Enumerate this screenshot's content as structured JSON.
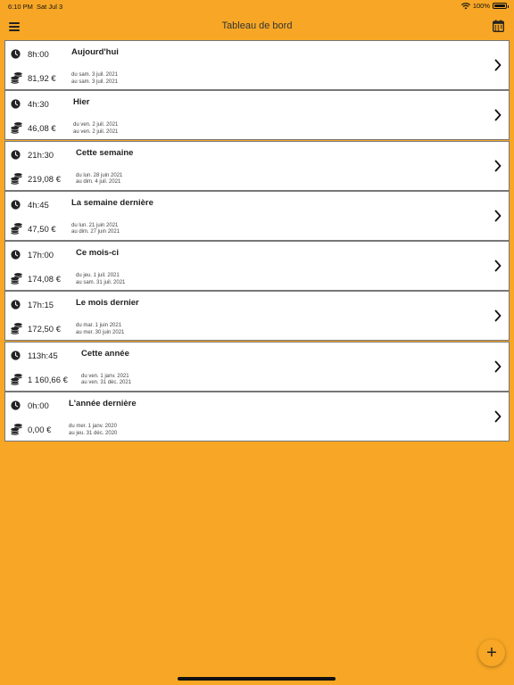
{
  "status_bar": {
    "time": "6:10 PM",
    "date": "Sat Jul 3",
    "battery": "100%",
    "battery_level": 1.0
  },
  "nav": {
    "title": "Tableau de bord",
    "menu_icon": "hamburger-menu-icon",
    "calendar_icon": "calendar-icon"
  },
  "periods": [
    {
      "hours": "8h:00",
      "amount": "81,92 €",
      "title": "Aujourd'hui",
      "from": "du sam. 3 juil. 2021",
      "to": "au sam. 3 juil. 2021"
    },
    {
      "hours": "4h:30",
      "amount": "46,08 €",
      "title": "Hier",
      "from": "du ven. 2 juil. 2021",
      "to": "au ven. 2 juil. 2021"
    },
    {
      "hours": "21h:30",
      "amount": "219,08 €",
      "title": "Cette semaine",
      "from": "du lun. 28 juin 2021",
      "to": "au dim. 4 juil. 2021"
    },
    {
      "hours": "4h:45",
      "amount": "47,50 €",
      "title": "La semaine dernière",
      "from": "du lun. 21 juin 2021",
      "to": "au dim. 27 juin 2021"
    },
    {
      "hours": "17h:00",
      "amount": "174,08 €",
      "title": "Ce mois-ci",
      "from": "du jeu. 1 juil. 2021",
      "to": "au sam. 31 juil. 2021"
    },
    {
      "hours": "17h:15",
      "amount": "172,50 €",
      "title": "Le mois dernier",
      "from": "du mar. 1 juin 2021",
      "to": "au mer. 30 juin 2021"
    },
    {
      "hours": "113h:45",
      "amount": "1 160,66 €",
      "title": "Cette année",
      "from": "du ven. 1 janv. 2021",
      "to": "au ven. 31 déc. 2021"
    },
    {
      "hours": "0h:00",
      "amount": "0,00 €",
      "title": "L'année dernière",
      "from": "du mer. 1 janv. 2020",
      "to": "au jeu. 31 déc. 2020"
    }
  ],
  "fab": {
    "label": "+"
  },
  "colors": {
    "background": "#F7A725",
    "card": "#FFFFFF",
    "text": "#222222"
  }
}
